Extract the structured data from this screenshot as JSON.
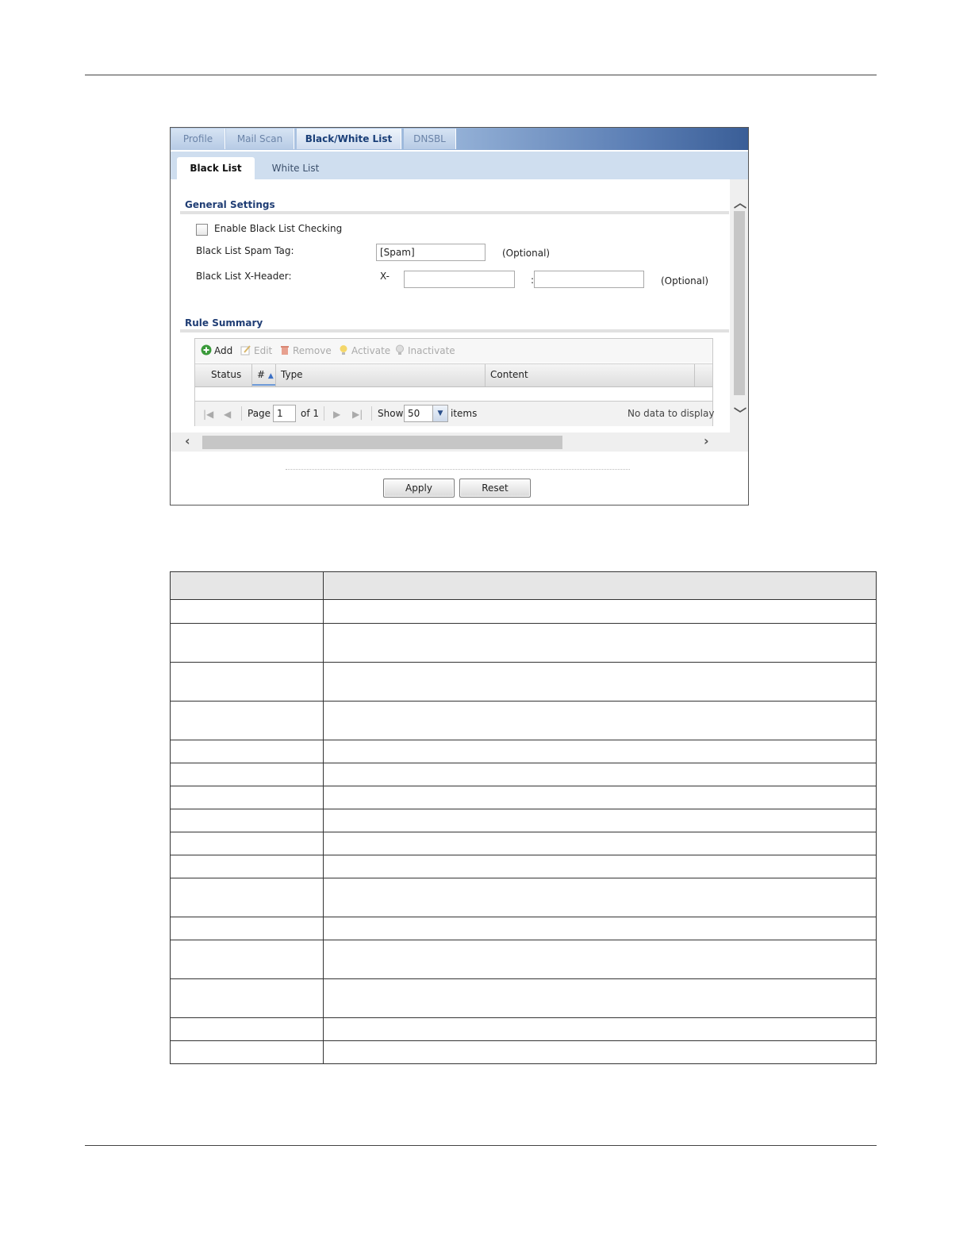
{
  "tabs": [
    "Profile",
    "Mail Scan",
    "Black/White List",
    "DNSBL"
  ],
  "active_tab": "Black/White List",
  "subtabs": [
    "Black List",
    "White List"
  ],
  "active_subtab": "Black List",
  "general_settings": {
    "title": "General Settings",
    "enable_label": "Enable Black List Checking",
    "enable_checked": false,
    "spam_tag_label": "Black List Spam Tag:",
    "spam_tag_value": "[Spam]",
    "spam_tag_optional": "(Optional)",
    "xheader_label": "Black List X-Header:",
    "xheader_prefix": "X-",
    "xheader_separator": ":",
    "xheader_name_value": "",
    "xheader_value_value": "",
    "xheader_optional": "(Optional)"
  },
  "rule_summary": {
    "title": "Rule Summary",
    "toolbar": {
      "add": "Add",
      "edit": "Edit",
      "remove": "Remove",
      "activate": "Activate",
      "inactivate": "Inactivate"
    },
    "columns": [
      "Status",
      "#",
      "Type",
      "Content"
    ],
    "footer": {
      "page_label": "Page",
      "page_value": "1",
      "of_label": "of 1",
      "show_label": "Show",
      "show_value": "50",
      "items_label": "items",
      "status_text": "No data to display"
    }
  },
  "buttons": {
    "apply": "Apply",
    "reset": "Reset"
  },
  "colors": {
    "tab_active_text": "#1a3f78",
    "section_title": "#1f3d74",
    "add_icon": "#3a9a3a"
  }
}
